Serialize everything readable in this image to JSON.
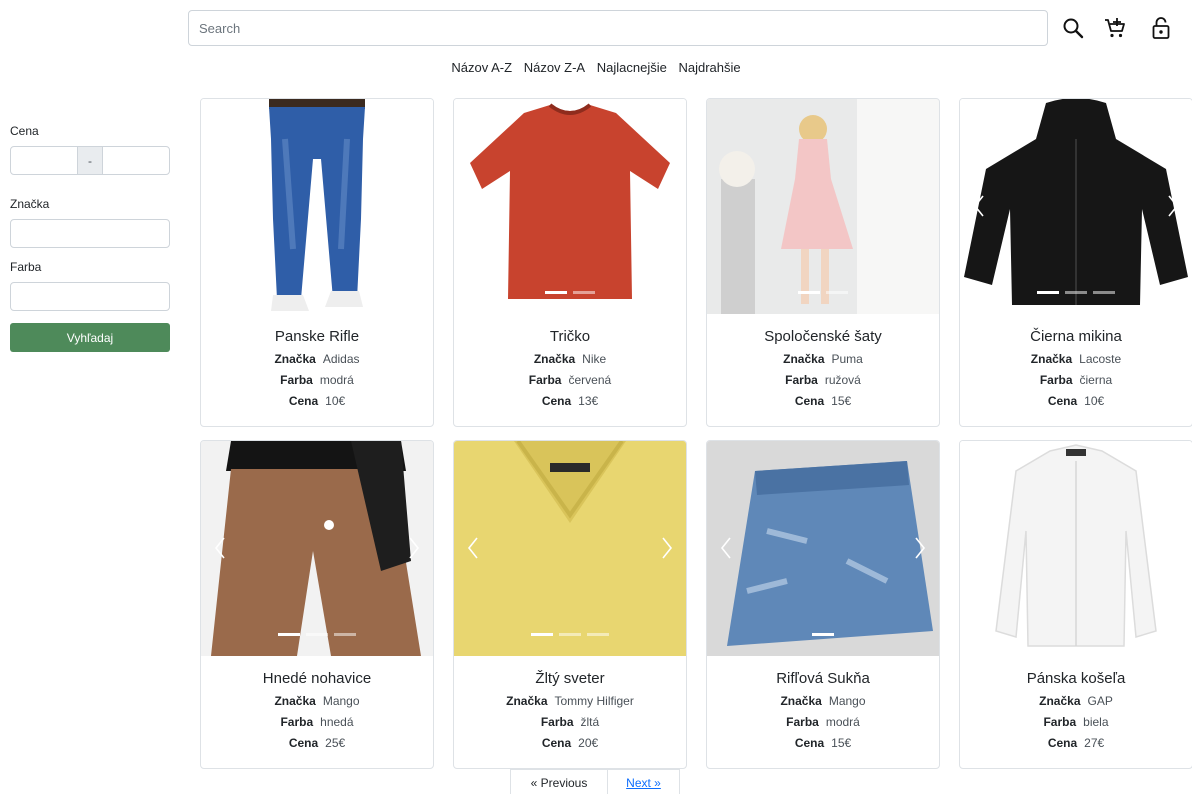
{
  "search": {
    "placeholder": "Search"
  },
  "sort": [
    "Názov A-Z",
    "Názov Z-A",
    "Najlacnejšie",
    "Najdrahšie"
  ],
  "filters": {
    "price_label": "Cena",
    "range_separator": "-",
    "brand_label": "Značka",
    "color_label": "Farba",
    "submit_label": "Vyhľadaj"
  },
  "attr_labels": {
    "brand": "Značka",
    "color": "Farba",
    "price": "Cena"
  },
  "products": [
    {
      "name": "Panske Rifle",
      "brand": "Adidas",
      "color": "modrá",
      "price": "10€"
    },
    {
      "name": "Tričko",
      "brand": "Nike",
      "color": "červená",
      "price": "13€"
    },
    {
      "name": "Spoločenské šaty",
      "brand": "Puma",
      "color": "ružová",
      "price": "15€"
    },
    {
      "name": "Čierna mikina",
      "brand": "Lacoste",
      "color": "čierna",
      "price": "10€"
    },
    {
      "name": "Hnedé nohavice",
      "brand": "Mango",
      "color": "hnedá",
      "price": "25€"
    },
    {
      "name": "Žltý sveter",
      "brand": "Tommy Hilfiger",
      "color": "žltá",
      "price": "20€"
    },
    {
      "name": "Rifľová Sukňa",
      "brand": "Mango",
      "color": "modrá",
      "price": "15€"
    },
    {
      "name": "Pánska košeľa",
      "brand": "GAP",
      "color": "biela",
      "price": "27€"
    }
  ],
  "pagination": {
    "prev_label": "« Previous",
    "next_label": "Next »"
  },
  "icons": [
    "search-icon",
    "add-to-cart-icon",
    "lock-icon"
  ],
  "colors": {
    "primary_button": "#4e8a5a",
    "link": "#0d6efd"
  }
}
